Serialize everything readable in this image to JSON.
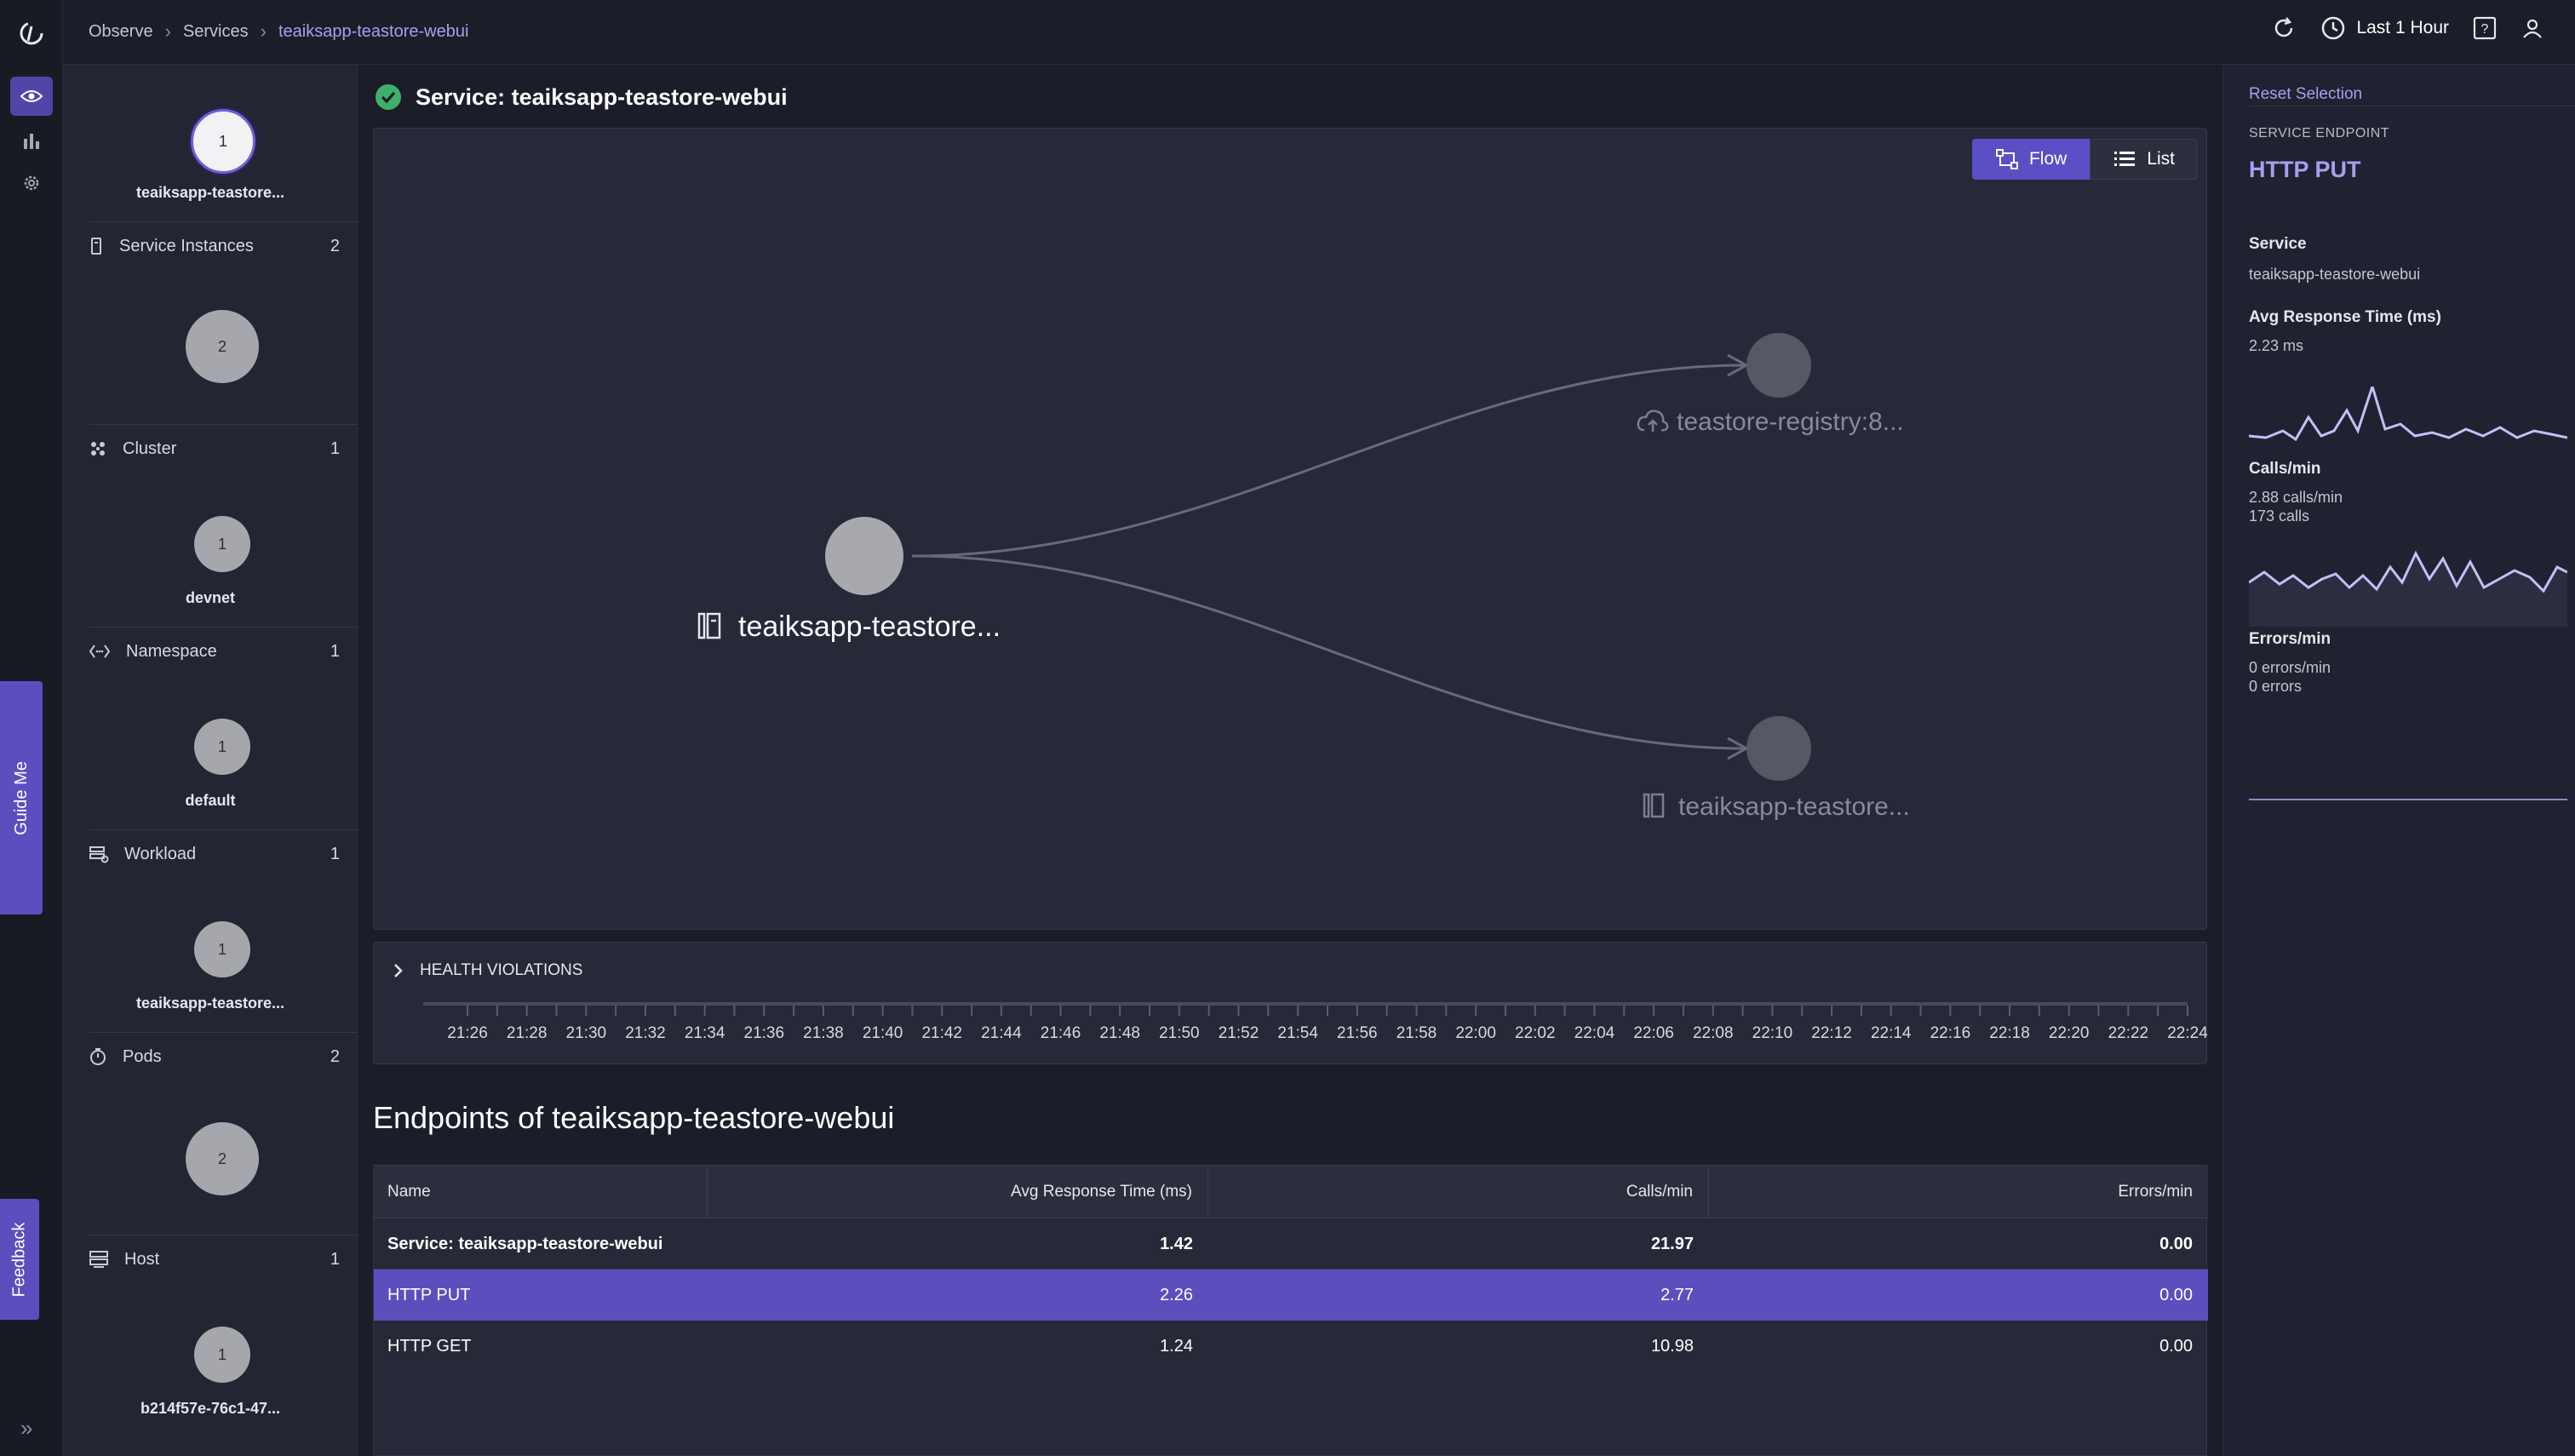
{
  "nav": {
    "guide_label": "Guide Me",
    "feedback_label": "Feedback"
  },
  "breadcrumb": {
    "items": [
      "Observe",
      "Services",
      "teaiksapp-teastore-webui"
    ]
  },
  "topbar": {
    "time_range": "Last 1 Hour"
  },
  "entities": {
    "top": {
      "count": "1",
      "label": "teaiksapp-teastore..."
    },
    "sections": [
      {
        "name": "Service Instances",
        "count": "2",
        "node": "2",
        "label": ""
      },
      {
        "name": "Cluster",
        "count": "1",
        "node": "1",
        "label": "devnet"
      },
      {
        "name": "Namespace",
        "count": "1",
        "node": "1",
        "label": "default"
      },
      {
        "name": "Workload",
        "count": "1",
        "node": "1",
        "label": "teaiksapp-teastore..."
      },
      {
        "name": "Pods",
        "count": "2",
        "node": "2",
        "label": ""
      },
      {
        "name": "Host",
        "count": "1",
        "node": "1",
        "label": "b214f57e-76c1-47..."
      }
    ]
  },
  "service": {
    "title": "Service: teaiksapp-teastore-webui"
  },
  "view_toggle": {
    "flow": "Flow",
    "list": "List"
  },
  "flow": {
    "source": "teaiksapp-teastore...",
    "targets": [
      "teastore-registry:8...",
      "teaiksapp-teastore..."
    ]
  },
  "health": {
    "title": "HEALTH VIOLATIONS",
    "ticks": [
      "21:26",
      "21:28",
      "21:30",
      "21:32",
      "21:34",
      "21:36",
      "21:38",
      "21:40",
      "21:42",
      "21:44",
      "21:46",
      "21:48",
      "21:50",
      "21:52",
      "21:54",
      "21:56",
      "21:58",
      "22:00",
      "22:02",
      "22:04",
      "22:06",
      "22:08",
      "22:10",
      "22:12",
      "22:14",
      "22:16",
      "22:18",
      "22:20",
      "22:22",
      "22:24"
    ]
  },
  "endpoints": {
    "title": "Endpoints of teaiksapp-teastore-webui",
    "columns": [
      "Name",
      "Avg Response Time (ms)",
      "Calls/min",
      "Errors/min"
    ],
    "rows": [
      {
        "name": "Service: teaiksapp-teastore-webui",
        "avg": "1.42",
        "calls": "21.97",
        "errors": "0.00"
      },
      {
        "name": "HTTP PUT",
        "avg": "2.26",
        "calls": "2.77",
        "errors": "0.00"
      },
      {
        "name": "HTTP GET",
        "avg": "1.24",
        "calls": "10.98",
        "errors": "0.00"
      }
    ]
  },
  "panel": {
    "reset": "Reset Selection",
    "kind": "SERVICE ENDPOINT",
    "endpoint": "HTTP PUT",
    "service_label": "Service",
    "service_value": "teaiksapp-teastore-webui",
    "avg_label": "Avg Response Time (ms)",
    "avg_value": "2.23 ms",
    "calls_label": "Calls/min",
    "calls_value": "2.88 calls/min",
    "calls_total": "173 calls",
    "errors_label": "Errors/min",
    "errors_value": "0 errors/min",
    "errors_total": "0 errors"
  },
  "colors": {
    "accent": "#5b4fc0",
    "accent_text": "#a89ff0",
    "ok": "#3fb06a",
    "spark": "#c7bdf7"
  }
}
